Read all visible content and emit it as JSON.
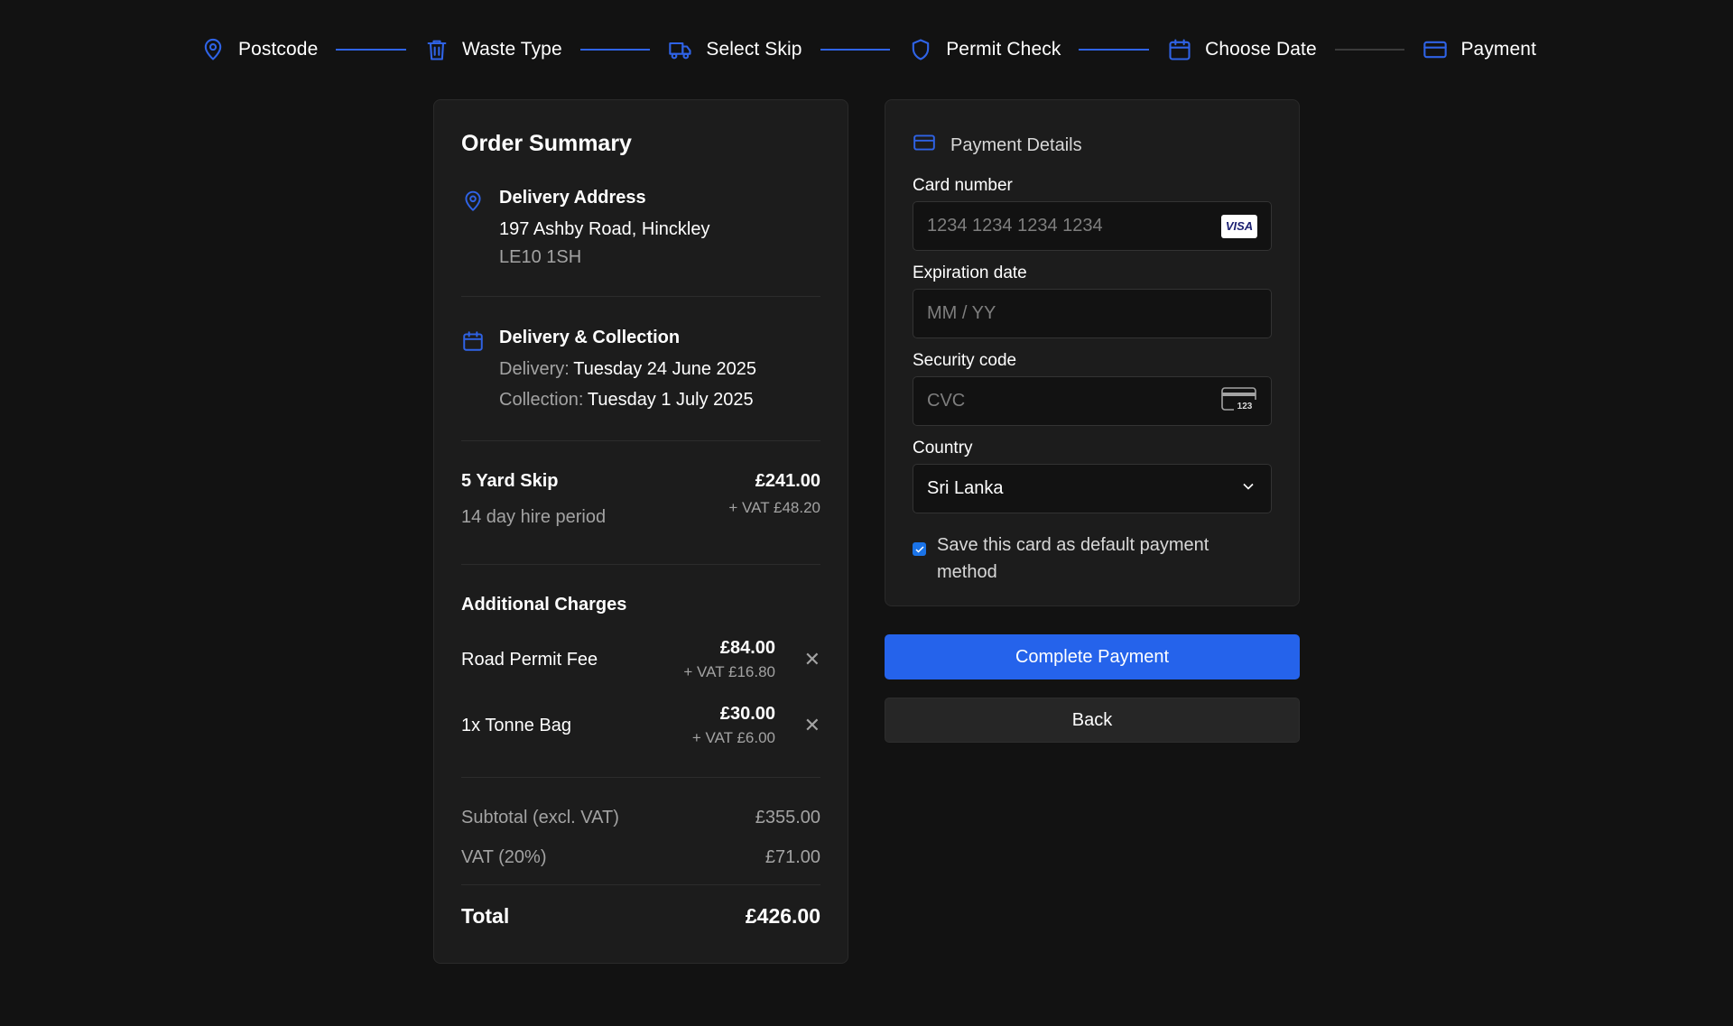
{
  "stepper": {
    "steps": [
      {
        "label": "Postcode",
        "icon": "map-pin-icon"
      },
      {
        "label": "Waste Type",
        "icon": "trash-icon"
      },
      {
        "label": "Select Skip",
        "icon": "truck-icon"
      },
      {
        "label": "Permit Check",
        "icon": "shield-icon"
      },
      {
        "label": "Choose Date",
        "icon": "calendar-icon"
      },
      {
        "label": "Payment",
        "icon": "credit-card-icon"
      }
    ],
    "active_color": "#2f63e6",
    "inactive_color": "#3a3a3a"
  },
  "summary": {
    "title": "Order Summary",
    "delivery_address": {
      "title": "Delivery Address",
      "line1": "197 Ashby Road, Hinckley",
      "postcode": "LE10 1SH"
    },
    "schedule": {
      "title": "Delivery & Collection",
      "delivery_label": "Delivery:",
      "delivery_date": "Tuesday 24 June 2025",
      "collection_label": "Collection:",
      "collection_date": "Tuesday 1 July 2025"
    },
    "skip": {
      "name": "5 Yard Skip",
      "period": "14 day hire period",
      "price": "£241.00",
      "vat": "+ VAT £48.20"
    },
    "additional": {
      "title": "Additional Charges",
      "items": [
        {
          "name": "Road Permit Fee",
          "price": "£84.00",
          "vat": "+ VAT £16.80"
        },
        {
          "name": "1x Tonne Bag",
          "price": "£30.00",
          "vat": "+ VAT £6.00"
        }
      ]
    },
    "subtotal_label": "Subtotal (excl. VAT)",
    "subtotal_value": "£355.00",
    "vat_label": "VAT (20%)",
    "vat_value": "£71.00",
    "total_label": "Total",
    "total_value": "£426.00"
  },
  "payment": {
    "title": "Payment Details",
    "card_number_label": "Card number",
    "card_number_placeholder": "1234 1234 1234 1234",
    "card_brand": "VISA",
    "expiry_label": "Expiration date",
    "expiry_placeholder": "MM / YY",
    "cvc_label": "Security code",
    "cvc_placeholder": "CVC",
    "cvc_icon_text": "123",
    "country_label": "Country",
    "country_value": "Sri Lanka",
    "save_card_label": "Save this card as default payment method",
    "save_card_checked": true
  },
  "actions": {
    "complete_label": "Complete Payment",
    "back_label": "Back",
    "primary_color": "#2563eb"
  }
}
